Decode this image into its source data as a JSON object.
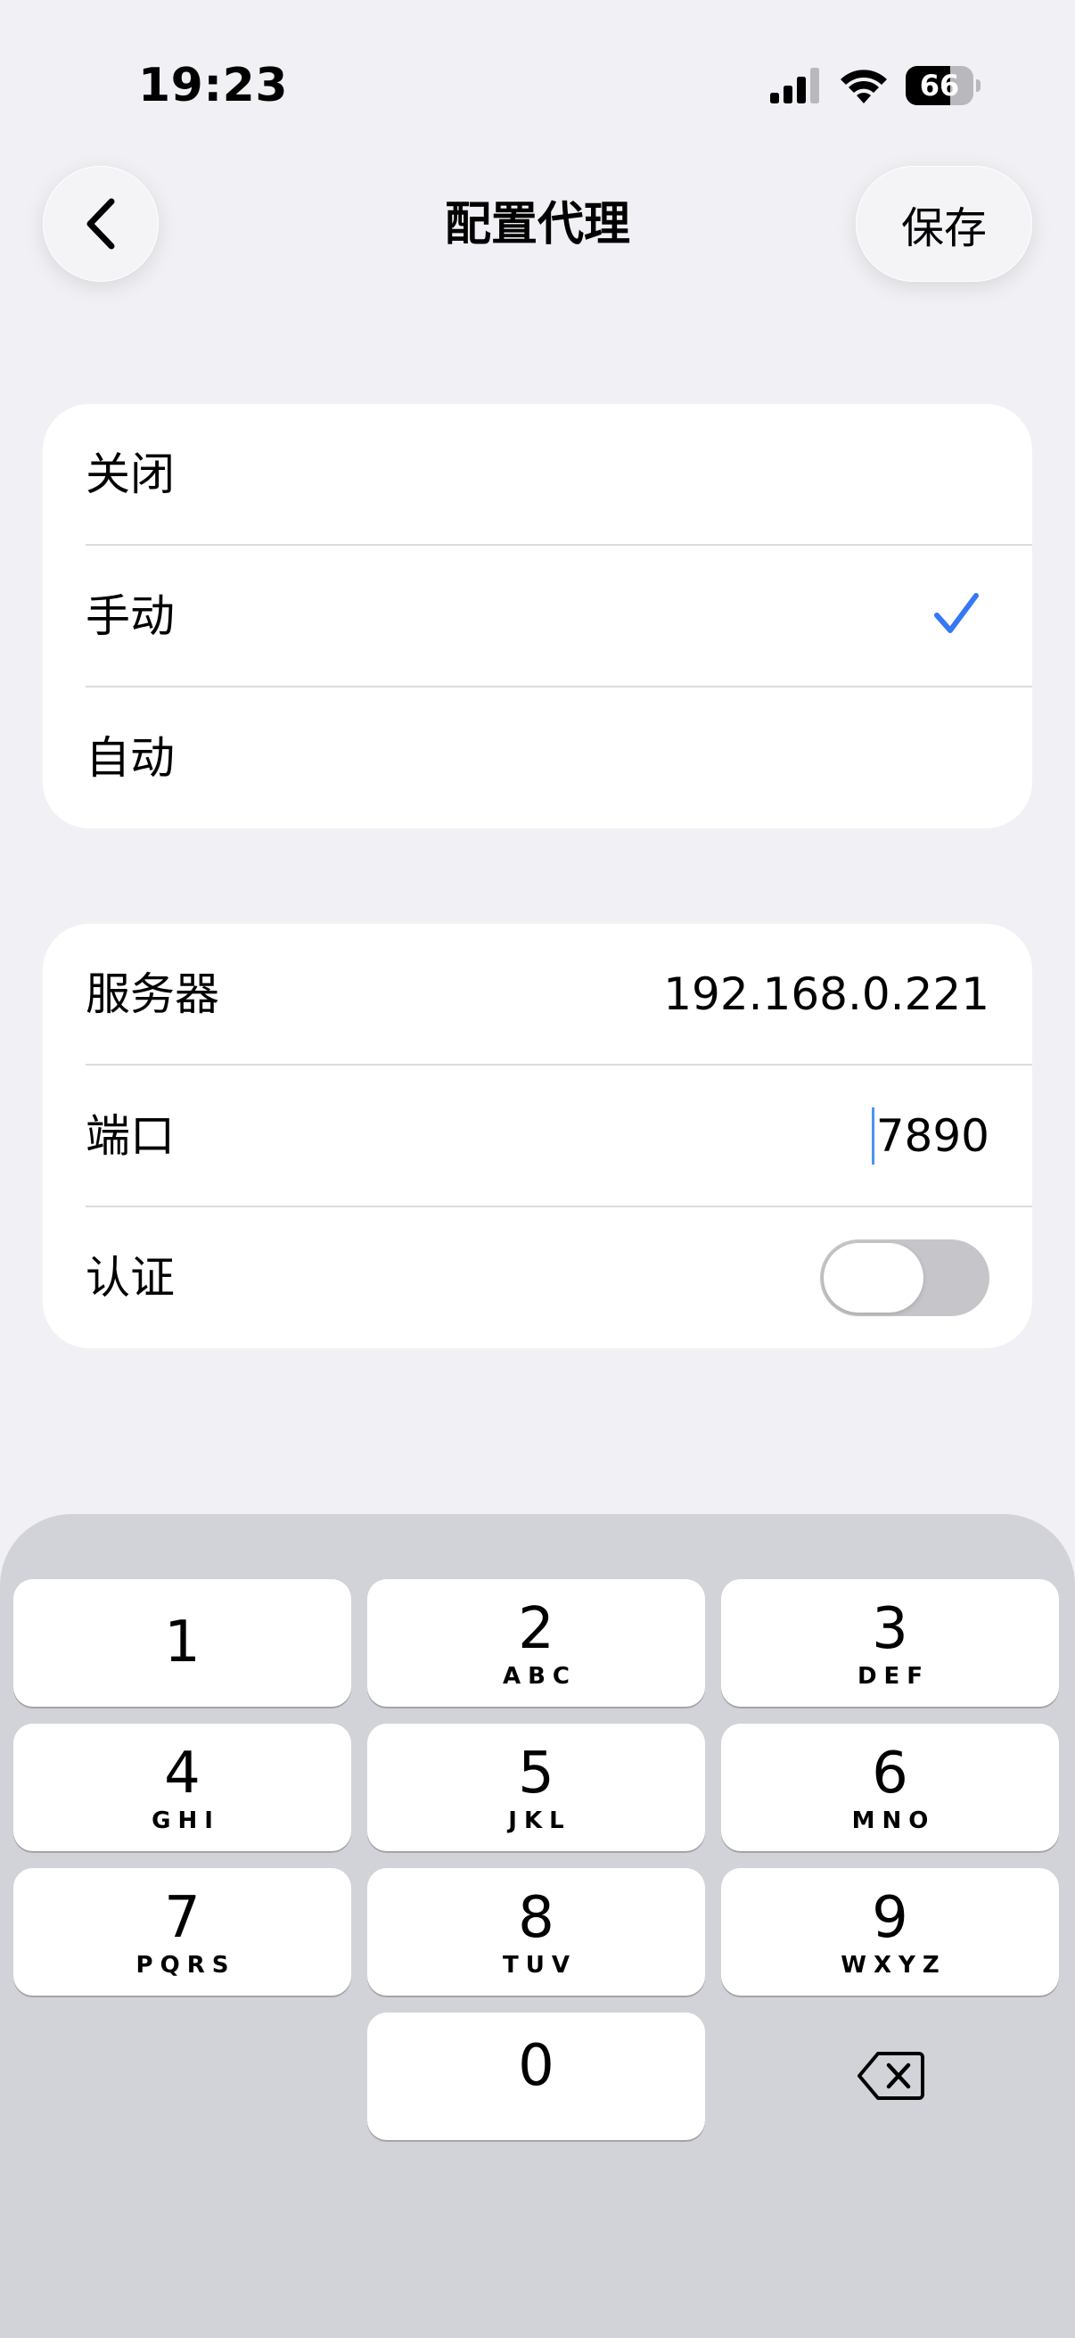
{
  "status_bar": {
    "time": "19:23",
    "battery_level": 66,
    "battery_text": "66",
    "icons": [
      "cellular-signal-icon",
      "wifi-icon",
      "battery-icon"
    ]
  },
  "nav": {
    "back_icon": "chevron-left-icon",
    "title": "配置代理",
    "save_label": "保存"
  },
  "proxy_mode": {
    "options": [
      {
        "label": "关闭",
        "selected": false
      },
      {
        "label": "手动",
        "selected": true
      },
      {
        "label": "自动",
        "selected": false
      }
    ],
    "check_icon": "checkmark-icon",
    "accent_color": "#3478f6"
  },
  "proxy_settings": {
    "server_label": "服务器",
    "server_value": "192.168.0.221",
    "port_label": "端口",
    "port_value": "7890",
    "auth_label": "认证",
    "auth_enabled": false
  },
  "keypad": {
    "keys": [
      {
        "digit": "1",
        "letters": ""
      },
      {
        "digit": "2",
        "letters": "ABC"
      },
      {
        "digit": "3",
        "letters": "DEF"
      },
      {
        "digit": "4",
        "letters": "GHI"
      },
      {
        "digit": "5",
        "letters": "JKL"
      },
      {
        "digit": "6",
        "letters": "MNO"
      },
      {
        "digit": "7",
        "letters": "PQRS"
      },
      {
        "digit": "8",
        "letters": "TUV"
      },
      {
        "digit": "9",
        "letters": "WXYZ"
      },
      {
        "digit": "0",
        "letters": ""
      }
    ],
    "backspace_icon": "backspace-icon"
  }
}
